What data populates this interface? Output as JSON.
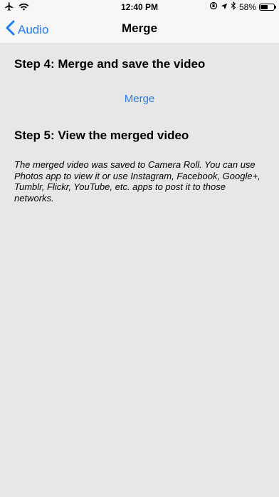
{
  "status_bar": {
    "time": "12:40 PM",
    "battery_percent": "58%",
    "battery_level": 0.58,
    "icons": [
      "airplane-icon",
      "wifi-icon",
      "orientation-lock-icon",
      "location-icon",
      "bluetooth-icon",
      "battery-icon"
    ]
  },
  "nav": {
    "back_label": "Audio",
    "title": "Merge"
  },
  "content": {
    "step4_heading": "Step 4: Merge and save the video",
    "merge_button_label": "Merge",
    "step5_heading": "Step 5: View the merged video",
    "description": "The merged video was saved to Camera Roll. You can use Photos app to view it or use Instagram, Facebook, Google+, Tumblr, Flickr, YouTube, etc. apps to post it to those networks."
  },
  "colors": {
    "accent": "#1c7bf6",
    "background": "#e7e7e7",
    "bar_background": "#f7f7f7"
  }
}
